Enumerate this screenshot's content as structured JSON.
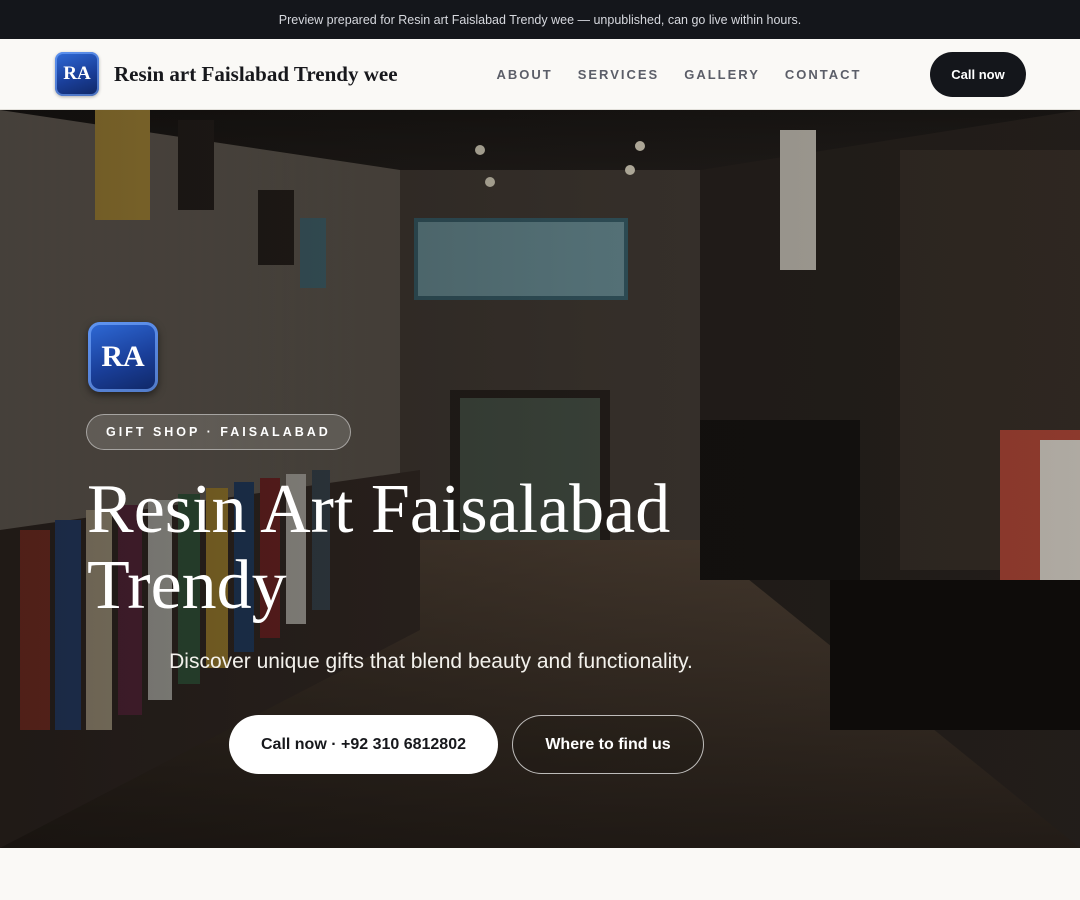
{
  "preview_bar": {
    "text": "Preview prepared for Resin art Faislabad Trendy wee — unpublished, can go live within hours."
  },
  "header": {
    "logo_initials": "RA",
    "brand_name": "Resin art Faislabad Trendy wee",
    "nav": [
      {
        "label": "ABOUT"
      },
      {
        "label": "SERVICES"
      },
      {
        "label": "GALLERY"
      },
      {
        "label": "CONTACT"
      }
    ],
    "call_label": "Call now"
  },
  "hero": {
    "background_image": "gift-shop-interior-photo",
    "logo_initials": "RA",
    "badge": "GIFT SHOP · FAISALABAD",
    "title": "Resin Art Faisalabad Trendy",
    "subtitle": "Discover unique gifts that blend beauty and functionality.",
    "primary_cta": "Call now · +92 310 6812802",
    "secondary_cta": "Where to find us"
  },
  "colors": {
    "dark": "#14161b",
    "page_bg": "#faf9f6",
    "logo_blue": "#1a3f9a",
    "nav_text": "#5b5e68"
  }
}
